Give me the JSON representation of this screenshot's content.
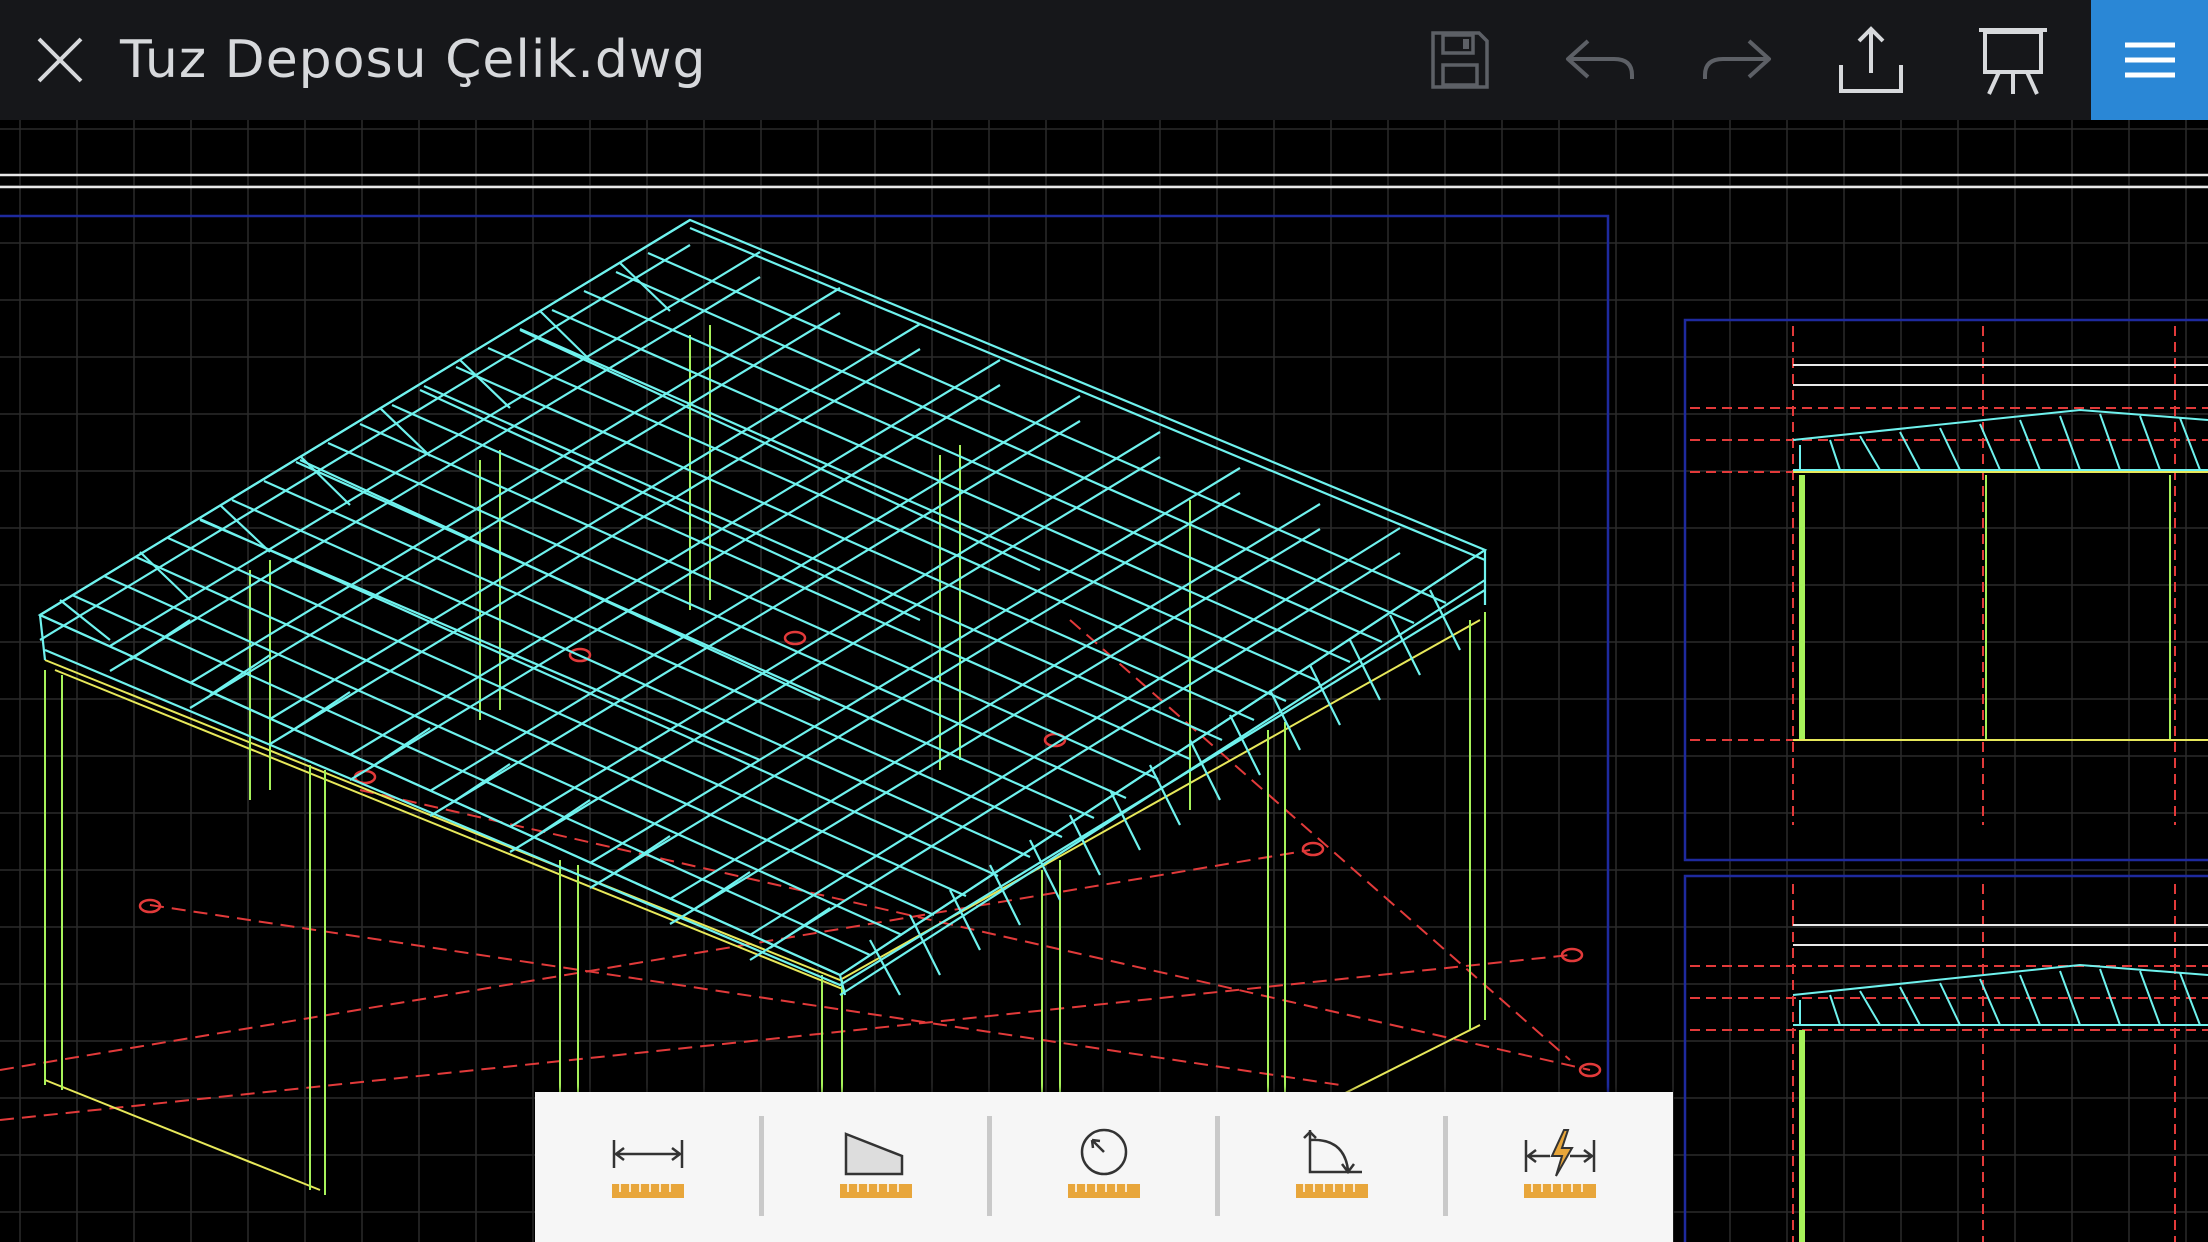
{
  "app": {
    "file_title": "Tuz Deposu Çelik.dwg"
  },
  "toolbar": {
    "icons": [
      "close-icon",
      "save-icon",
      "undo-icon",
      "redo-icon",
      "share-icon",
      "present-icon",
      "menu-icon"
    ],
    "menu_color": "#2a87d6"
  },
  "measure_tools": {
    "icons": [
      "measure-distance-icon",
      "measure-area-icon",
      "measure-radius-icon",
      "measure-angle-icon",
      "quick-measure-icon"
    ],
    "accent_color": "#e8a63b"
  },
  "drawing": {
    "colors": {
      "steel": "#6ff2ee",
      "column": "#a7f25a",
      "beam": "#e7e85a",
      "axis": "#e23a3a",
      "border": "#1e2a9e",
      "grid": "#2b2b2b"
    }
  }
}
